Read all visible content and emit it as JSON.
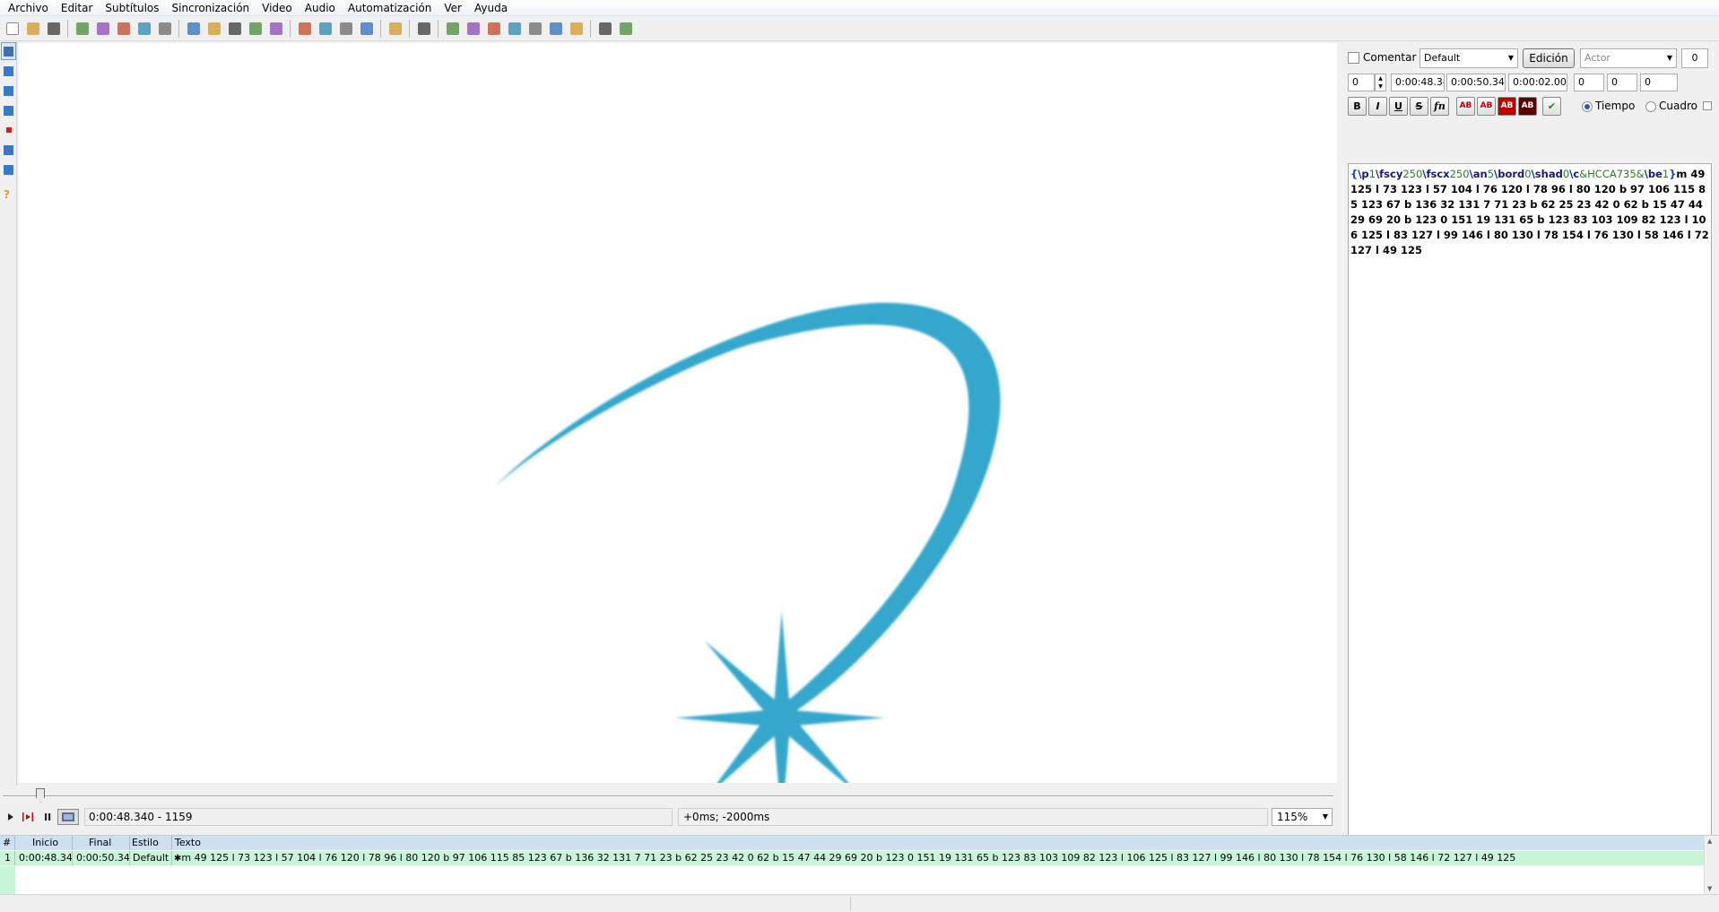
{
  "menu": [
    "Archivo",
    "Editar",
    "Subtítulos",
    "Sincronización",
    "Video",
    "Audio",
    "Automatización",
    "Ver",
    "Ayuda"
  ],
  "toolbar": {
    "icons": [
      "new-file-icon",
      "open-file-icon",
      "save-icon",
      "sep",
      "jump-icon",
      "zoom-in-icon",
      "zoom-out-icon",
      "properties-icon",
      "attachments-icon",
      "sep",
      "styles-manager-icon",
      "styles-icon",
      "fonts-collector-icon",
      "video-details-icon",
      "resample-icon",
      "sep",
      "spellcheck-icon",
      "translation-icon",
      "select-lines-icon",
      "shift-times-icon",
      "sep",
      "automation-icon",
      "sep",
      "kanji-timer-icon",
      "sep",
      "timing-post-icon",
      "translate-icon",
      "fix-icon",
      "stop-icon",
      "clock-icon",
      "timing-icon",
      "check-icon",
      "sep",
      "tools-icon",
      "tag-icon"
    ]
  },
  "sidetools": [
    "standard-tool-icon",
    "drag-tool-icon",
    "rotate-z-tool-icon",
    "rotate-xy-tool-icon",
    "scale-tool-icon",
    "clip-tool-icon",
    "vector-clip-tool-icon",
    "help-icon"
  ],
  "controls": {
    "time_display": "0:00:48.340 - 1159",
    "offset_display": "+0ms; -2000ms",
    "zoom": "115%"
  },
  "edit": {
    "comment_label": "Comentar",
    "style": "Default",
    "edit_button": "Edición",
    "actor_placeholder": "Actor",
    "effect_value": "0",
    "layer": "0",
    "start_time": "0:00:48.34",
    "end_time": "0:00:50.34",
    "duration": "0:00:02.00",
    "margin_l": "0",
    "margin_r": "0",
    "margin_v": "0",
    "bold": "B",
    "italic": "I",
    "underline": "U",
    "strike": "S",
    "font": "fn",
    "color1": "AB",
    "color2": "AB",
    "color3": "AB",
    "color4": "AB",
    "time_radio": "Tiempo",
    "frame_radio": "Cuadro",
    "text_tags": [
      {
        "k": "brace",
        "t": "{"
      },
      {
        "k": "slash",
        "t": "\\"
      },
      {
        "k": "name",
        "t": "p"
      },
      {
        "k": "val",
        "t": "1"
      },
      {
        "k": "slash",
        "t": "\\"
      },
      {
        "k": "name",
        "t": "fscy"
      },
      {
        "k": "val",
        "t": "250"
      },
      {
        "k": "slash",
        "t": "\\"
      },
      {
        "k": "name",
        "t": "fscx"
      },
      {
        "k": "val",
        "t": "250"
      },
      {
        "k": "slash",
        "t": "\\"
      },
      {
        "k": "name",
        "t": "an"
      },
      {
        "k": "val",
        "t": "5"
      },
      {
        "k": "slash",
        "t": "\\"
      },
      {
        "k": "name",
        "t": "bord"
      },
      {
        "k": "val",
        "t": "0"
      },
      {
        "k": "slash",
        "t": "\\"
      },
      {
        "k": "name",
        "t": "shad"
      },
      {
        "k": "val",
        "t": "0"
      },
      {
        "k": "slash",
        "t": "\\"
      },
      {
        "k": "name",
        "t": "c"
      },
      {
        "k": "val",
        "t": "&HCCA735&"
      },
      {
        "k": "slash",
        "t": "\\"
      },
      {
        "k": "name",
        "t": "be"
      },
      {
        "k": "val",
        "t": "1"
      },
      {
        "k": "brace",
        "t": "}"
      }
    ],
    "text_drawing": "m 49 125 l 73 123 l 57 104 l 76 120 l 78 96 l 80 120 b 97 106 115 85 123 67 b 136 32 131 7 71 23 b 62 25 23 42 0 62 b 15 47 44 29 69 20 b 123 0 151 19 131 65 b 123 83 103 109 82 123 l 106 125 l 83 127 l 99 146 l 80 130 l 78 154 l 76 130 l 58 146 l 72 127 l 49 125"
  },
  "grid": {
    "headers": [
      "#",
      "Inicio",
      "Final",
      "Estilo",
      "Texto"
    ],
    "row": {
      "num": "1",
      "start": "0:00:48.34",
      "end": "0:00:50.34",
      "style": "Default",
      "text": "m 49 125 l 73 123 l 57 104 l 76 120 l 78 96 l 80 120 b 97 106 115 85 123 67 b 136 32 131 7 71 23 b 62 25 23 42 0 62 b 15 47 44 29 69 20 b 123 0 151 19 131 65 b 123 83 103 109 82 123 l 106 125 l 83 127 l 99 146 l 80 130 l 78 154 l 76 130 l 58 146 l 72 127 l 49 125"
    }
  },
  "colors": {
    "drawing": "#35a7cc",
    "grid_header": "#cde0f2",
    "grid_row": "#c8f5d8"
  }
}
